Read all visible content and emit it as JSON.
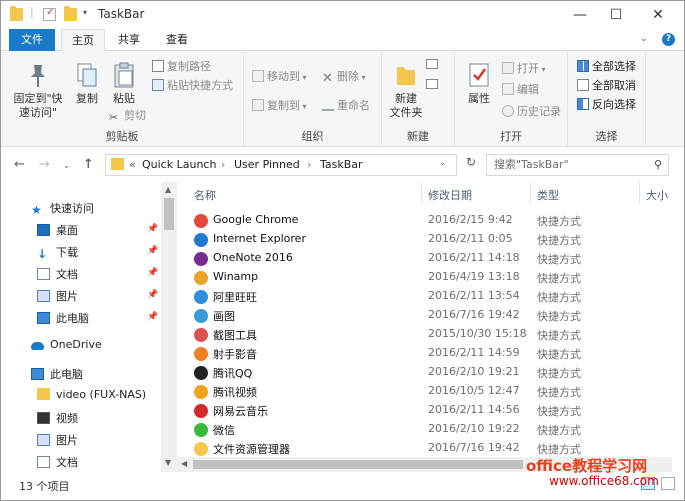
{
  "window": {
    "title": "TaskBar",
    "minimize": "—",
    "maximize": "☐",
    "close": "✕"
  },
  "tabs": {
    "file": "文件",
    "home": "主页",
    "share": "共享",
    "view": "查看"
  },
  "ribbon": {
    "clipboard": {
      "pin": "固定到\"快速访问\"",
      "pin1": "固定到\"快",
      "pin2": "速访问\"",
      "copy": "复制",
      "paste": "粘贴",
      "copy_path": "复制路径",
      "paste_shortcut": "粘贴快捷方式",
      "cut": "剪切",
      "label": "剪贴板"
    },
    "organize": {
      "move_to": "移动到",
      "copy_to": "复制到",
      "delete": "删除",
      "rename": "重命名",
      "label": "组织"
    },
    "new": {
      "new_folder1": "新建",
      "new_folder2": "文件夹",
      "label": "新建"
    },
    "open": {
      "properties": "属性",
      "open": "打开",
      "edit": "编辑",
      "history": "历史记录",
      "label": "打开"
    },
    "select": {
      "select_all": "全部选择",
      "select_none": "全部取消",
      "invert": "反向选择",
      "label": "选择"
    }
  },
  "address": {
    "crumbs": [
      "Quick Launch",
      "User Pinned",
      "TaskBar"
    ],
    "sep": "›",
    "overflow": "«",
    "search_placeholder": "搜索\"TaskBar\""
  },
  "sidebar": [
    {
      "label": "快速访问",
      "icon": "star-icon"
    },
    {
      "label": "桌面",
      "icon": "desktop-icon"
    },
    {
      "label": "下载",
      "icon": "download-icon"
    },
    {
      "label": "文档",
      "icon": "document-icon"
    },
    {
      "label": "图片",
      "icon": "picture-icon"
    },
    {
      "label": "此电脑",
      "icon": "computer-icon"
    },
    {
      "label": "OneDrive",
      "icon": "cloud-icon"
    },
    {
      "label": "此电脑",
      "icon": "computer-icon"
    },
    {
      "label": "video (FUX-NAS)",
      "icon": "network-drive-icon"
    },
    {
      "label": "视频",
      "icon": "video-icon"
    },
    {
      "label": "图片",
      "icon": "picture-icon"
    },
    {
      "label": "文档",
      "icon": "document-icon"
    }
  ],
  "columns": {
    "name": "名称",
    "date": "修改日期",
    "type": "类型",
    "size": "大小"
  },
  "files": [
    {
      "name": "Google Chrome",
      "date": "2016/2/15 9:42",
      "type": "快捷方式",
      "color": "#e04a3a"
    },
    {
      "name": "Internet Explorer",
      "date": "2016/2/11 0:05",
      "type": "快捷方式",
      "color": "#1f7bd1"
    },
    {
      "name": "OneNote 2016",
      "date": "2016/2/11 14:18",
      "type": "快捷方式",
      "color": "#7a2b8f"
    },
    {
      "name": "Winamp",
      "date": "2016/4/19 13:18",
      "type": "快捷方式",
      "color": "#e8a42b"
    },
    {
      "name": "阿里旺旺",
      "date": "2016/2/11 13:54",
      "type": "快捷方式",
      "color": "#2e8fe0"
    },
    {
      "name": "画图",
      "date": "2016/7/16 19:42",
      "type": "快捷方式",
      "color": "#3a9bd6"
    },
    {
      "name": "截图工具",
      "date": "2015/10/30 15:18",
      "type": "快捷方式",
      "color": "#d9534f"
    },
    {
      "name": "射手影音",
      "date": "2016/2/11 14:59",
      "type": "快捷方式",
      "color": "#f07e22"
    },
    {
      "name": "腾讯QQ",
      "date": "2016/2/10 19:21",
      "type": "快捷方式",
      "color": "#222222"
    },
    {
      "name": "腾讯视频",
      "date": "2016/10/5 12:47",
      "type": "快捷方式",
      "color": "#f2a11c"
    },
    {
      "name": "网易云音乐",
      "date": "2016/2/11 14:56",
      "type": "快捷方式",
      "color": "#d42a2a"
    },
    {
      "name": "微信",
      "date": "2016/2/10 19:22",
      "type": "快捷方式",
      "color": "#3db83f"
    },
    {
      "name": "文件资源管理器",
      "date": "2016/7/16 19:42",
      "type": "快捷方式",
      "color": "#f3c74d"
    }
  ],
  "status": {
    "count": "13 个项目"
  },
  "watermark": {
    "line1": "office教程学习网",
    "line2": "www.office68.com"
  },
  "colors": {
    "accent": "#1979ca"
  }
}
